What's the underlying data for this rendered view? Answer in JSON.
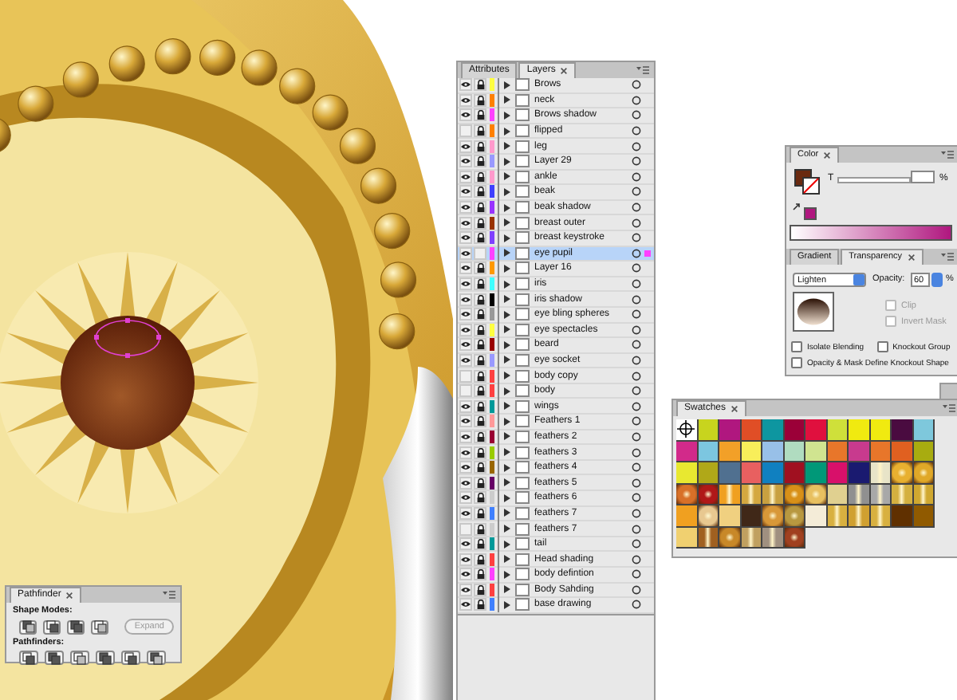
{
  "layers_panel": {
    "tabs": [
      {
        "label": "Attributes",
        "selected": false
      },
      {
        "label": "Layers",
        "selected": true
      }
    ],
    "layers": [
      {
        "name": "Brows",
        "visible": true,
        "locked": true,
        "color": "#ffff40",
        "selected": false
      },
      {
        "name": "neck",
        "visible": true,
        "locked": true,
        "color": "#ff8000",
        "selected": false
      },
      {
        "name": "Brows shadow",
        "visible": true,
        "locked": true,
        "color": "#ff40ff",
        "selected": false
      },
      {
        "name": "flipped",
        "visible": false,
        "locked": true,
        "color": "#ff8000",
        "selected": false
      },
      {
        "name": "leg",
        "visible": true,
        "locked": true,
        "color": "#ff99cc",
        "selected": false
      },
      {
        "name": "Layer 29",
        "visible": true,
        "locked": true,
        "color": "#9999ff",
        "selected": false
      },
      {
        "name": "ankle",
        "visible": true,
        "locked": true,
        "color": "#ff99cc",
        "selected": false
      },
      {
        "name": "beak",
        "visible": true,
        "locked": true,
        "color": "#4040ff",
        "selected": false
      },
      {
        "name": "beak shadow",
        "visible": true,
        "locked": true,
        "color": "#9933ff",
        "selected": false
      },
      {
        "name": "breast outer",
        "visible": true,
        "locked": true,
        "color": "#993300",
        "selected": false
      },
      {
        "name": "breast keystroke",
        "visible": true,
        "locked": true,
        "color": "#8040ff",
        "selected": false
      },
      {
        "name": "eye pupil",
        "visible": true,
        "locked": false,
        "color": "#ff40ff",
        "selected": true
      },
      {
        "name": "Layer 16",
        "visible": true,
        "locked": true,
        "color": "#ff9900",
        "selected": false
      },
      {
        "name": "iris",
        "visible": true,
        "locked": true,
        "color": "#40ffff",
        "selected": false
      },
      {
        "name": "iris shadow",
        "visible": true,
        "locked": true,
        "color": "#000000",
        "selected": false
      },
      {
        "name": "eye bling spheres",
        "visible": true,
        "locked": true,
        "color": "#999999",
        "selected": false
      },
      {
        "name": "eye spectacles",
        "visible": true,
        "locked": true,
        "color": "#ffff40",
        "selected": false
      },
      {
        "name": "beard",
        "visible": true,
        "locked": true,
        "color": "#990000",
        "selected": false
      },
      {
        "name": "eye socket",
        "visible": true,
        "locked": true,
        "color": "#9999ff",
        "selected": false
      },
      {
        "name": "body copy",
        "visible": false,
        "locked": true,
        "color": "#ff4040",
        "selected": false
      },
      {
        "name": "body",
        "visible": false,
        "locked": true,
        "color": "#ff4040",
        "selected": false
      },
      {
        "name": "wings",
        "visible": true,
        "locked": true,
        "color": "#009999",
        "selected": false
      },
      {
        "name": "Feathers 1",
        "visible": true,
        "locked": true,
        "color": "#ff9999",
        "selected": false
      },
      {
        "name": "feathers 2",
        "visible": true,
        "locked": true,
        "color": "#990033",
        "selected": false
      },
      {
        "name": "feathers 3",
        "visible": true,
        "locked": true,
        "color": "#99cc00",
        "selected": false
      },
      {
        "name": "feathers 4",
        "visible": true,
        "locked": true,
        "color": "#996600",
        "selected": false
      },
      {
        "name": "feathers 5",
        "visible": true,
        "locked": true,
        "color": "#660066",
        "selected": false
      },
      {
        "name": "feathers 6",
        "visible": true,
        "locked": true,
        "color": "#cccccc",
        "selected": false
      },
      {
        "name": "feathers 7",
        "visible": true,
        "locked": true,
        "color": "#4080ff",
        "selected": false
      },
      {
        "name": "feathers 7",
        "visible": false,
        "locked": true,
        "color": "#cccccc",
        "selected": false
      },
      {
        "name": "tail",
        "visible": true,
        "locked": true,
        "color": "#009999",
        "selected": false
      },
      {
        "name": "Head shading",
        "visible": true,
        "locked": true,
        "color": "#ff4040",
        "selected": false
      },
      {
        "name": "body defintion",
        "visible": true,
        "locked": true,
        "color": "#ff40ff",
        "selected": false
      },
      {
        "name": "Body Sahding",
        "visible": true,
        "locked": true,
        "color": "#ff4040",
        "selected": false
      },
      {
        "name": "base drawing",
        "visible": true,
        "locked": true,
        "color": "#4080ff",
        "selected": false
      }
    ]
  },
  "color_panel": {
    "title": "Color",
    "tint_label": "T",
    "tint_slider": {
      "level": 0
    },
    "percent": "%"
  },
  "transparency_panel": {
    "tabs": [
      {
        "label": "Gradient",
        "selected": false
      },
      {
        "label": "Transparency",
        "selected": true
      }
    ],
    "blend_mode": "Lighten",
    "opacity_label": "Opacity:",
    "opacity": "60",
    "percent": "%",
    "mask_options": [
      {
        "label": "Clip",
        "checked": false,
        "disabled": true
      },
      {
        "label": "Invert Mask",
        "checked": false,
        "disabled": true
      }
    ],
    "blend_options": [
      {
        "label": "Isolate Blending",
        "checked": false,
        "disabled": false
      },
      {
        "label": "Knockout Group",
        "checked": false,
        "disabled": false
      },
      {
        "label": "Opacity & Mask Define Knockout Shape",
        "checked": false,
        "disabled": false
      }
    ]
  },
  "swatches_panel": {
    "title": "Swatches",
    "swatches": [
      {
        "kind": "registration"
      },
      {
        "kind": "solid",
        "color": "#c8d41e"
      },
      {
        "kind": "solid",
        "color": "#b0177f"
      },
      {
        "kind": "solid",
        "color": "#e04e26"
      },
      {
        "kind": "solid",
        "color": "#0e96a0"
      },
      {
        "kind": "solid",
        "color": "#9b0038"
      },
      {
        "kind": "solid",
        "color": "#e0103e"
      },
      {
        "kind": "solid",
        "color": "#cfe03a"
      },
      {
        "kind": "solid",
        "color": "#f0ea10"
      },
      {
        "kind": "solid",
        "color": "#f0ea10"
      },
      {
        "kind": "solid",
        "color": "#4a0b40"
      },
      {
        "kind": "solid",
        "color": "#7ec8dc"
      },
      {
        "kind": "solid",
        "color": "#d22a8a"
      },
      {
        "kind": "solid",
        "color": "#7cc6e0"
      },
      {
        "kind": "solid",
        "color": "#f2a028"
      },
      {
        "kind": "solid",
        "color": "#f8ee5a"
      },
      {
        "kind": "solid",
        "color": "#98c0e8"
      },
      {
        "kind": "solid",
        "color": "#b0dcc0"
      },
      {
        "kind": "solid",
        "color": "#d0e490"
      },
      {
        "kind": "solid",
        "color": "#e8762a"
      },
      {
        "kind": "solid",
        "color": "#c83a8e"
      },
      {
        "kind": "solid",
        "color": "#e8762a"
      },
      {
        "kind": "solid",
        "color": "#e06020"
      },
      {
        "kind": "solid",
        "color": "#a8ac10"
      },
      {
        "kind": "solid",
        "color": "#e8e830"
      },
      {
        "kind": "solid",
        "color": "#b0a818"
      },
      {
        "kind": "solid",
        "color": "#507090"
      },
      {
        "kind": "solid",
        "color": "#e86060"
      },
      {
        "kind": "solid",
        "color": "#1080c0"
      },
      {
        "kind": "solid",
        "color": "#a01020"
      },
      {
        "kind": "solid",
        "color": "#009878"
      },
      {
        "kind": "solid",
        "color": "#d8106a"
      },
      {
        "kind": "solid",
        "color": "#1a1a70"
      },
      {
        "kind": "linear",
        "color": "#e8e4c8"
      },
      {
        "kind": "radial",
        "color": "#e8b030"
      },
      {
        "kind": "radial",
        "color": "#e0a828"
      },
      {
        "kind": "radial",
        "color": "#d87028"
      },
      {
        "kind": "radial",
        "color": "#b01818"
      },
      {
        "kind": "linear",
        "color": "#f0a020"
      },
      {
        "kind": "linear",
        "color": "#d4a840"
      },
      {
        "kind": "linear",
        "color": "#c8a040"
      },
      {
        "kind": "radial",
        "color": "#d89018"
      },
      {
        "kind": "radial",
        "color": "#e8c060"
      },
      {
        "kind": "solid",
        "color": "#e0d090"
      },
      {
        "kind": "linear",
        "color": "#909090"
      },
      {
        "kind": "linear",
        "color": "#a8a8a8"
      },
      {
        "kind": "linear",
        "color": "#d4b040"
      },
      {
        "kind": "linear",
        "color": "#d0a830"
      },
      {
        "kind": "solid",
        "color": "#f0a020"
      },
      {
        "kind": "radial",
        "color": "#e8c890"
      },
      {
        "kind": "solid",
        "color": "#f0d080"
      },
      {
        "kind": "solid",
        "color": "#402818"
      },
      {
        "kind": "radial",
        "color": "#d89838"
      },
      {
        "kind": "radial",
        "color": "#b89840"
      },
      {
        "kind": "solid",
        "color": "#f4ecd8"
      },
      {
        "kind": "linear",
        "color": "#d8b040"
      },
      {
        "kind": "linear",
        "color": "#d0a030"
      },
      {
        "kind": "linear",
        "color": "#d8b040"
      },
      {
        "kind": "solid",
        "color": "#603000"
      },
      {
        "kind": "solid",
        "color": "#905a00"
      },
      {
        "kind": "solid",
        "color": "#f0d070"
      },
      {
        "kind": "linear",
        "color": "#a06020"
      },
      {
        "kind": "radial",
        "color": "#c88828"
      },
      {
        "kind": "linear",
        "color": "#c0a060"
      },
      {
        "kind": "linear",
        "color": "#a09080"
      },
      {
        "kind": "radial",
        "color": "#a04020"
      }
    ]
  },
  "pathfinder_panel": {
    "title": "Pathfinder",
    "shape_modes_label": "Shape Modes:",
    "expand": {
      "label": "Expand",
      "disabled": true
    },
    "pathfinders_label": "Pathfinders:"
  }
}
